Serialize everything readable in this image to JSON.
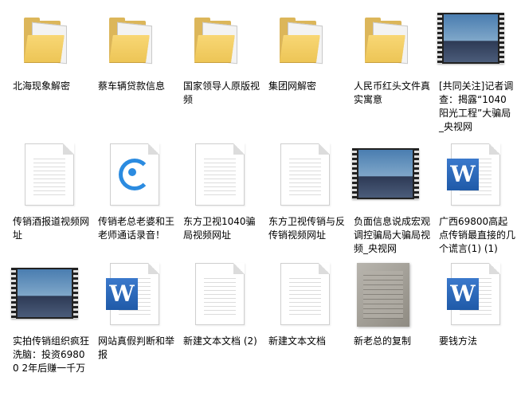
{
  "window": {
    "view": "large-icons",
    "background": "#ffffff"
  },
  "items": [
    {
      "label": "北海现象解密",
      "type": "folder"
    },
    {
      "label": "蔡车辆贷款信息",
      "type": "folder"
    },
    {
      "label": "国家领导人原版视频",
      "type": "folder"
    },
    {
      "label": "集团网解密",
      "type": "folder"
    },
    {
      "label": "人民币红头文件真实寓意",
      "type": "folder"
    },
    {
      "label": "[共同关注]记者调查：揭露“1040阳光工程”大骗局_央视网",
      "type": "video"
    },
    {
      "label": "传销酒报道视频网址",
      "type": "text"
    },
    {
      "label": "传销老总老婆和王老师通话录音！",
      "type": "audio"
    },
    {
      "label": "东方卫视1040骗局视频网址",
      "type": "text"
    },
    {
      "label": "东方卫视传销与反传销视频网址",
      "type": "text"
    },
    {
      "label": "负面信息说成宏观调控骗局大骗局视频_央视网",
      "type": "video"
    },
    {
      "label": "广西69800高起点传销最直接的几个谎言(1) (1)",
      "type": "word"
    },
    {
      "label": "实拍传销组织疯狂洗脑：投资69800 2年后赚一千万",
      "type": "video"
    },
    {
      "label": "网站真假判断和举报",
      "type": "word"
    },
    {
      "label": "新建文本文档 (2)",
      "type": "text"
    },
    {
      "label": "新建文本文档",
      "type": "text"
    },
    {
      "label": "新老总的复制",
      "type": "image"
    },
    {
      "label": "要钱方法",
      "type": "word"
    }
  ],
  "colors": {
    "folder": "#f8d775",
    "folder_dark": "#dcb65a",
    "word_blue": "#1f5aa8",
    "ring_blue": "#2b8be0"
  }
}
